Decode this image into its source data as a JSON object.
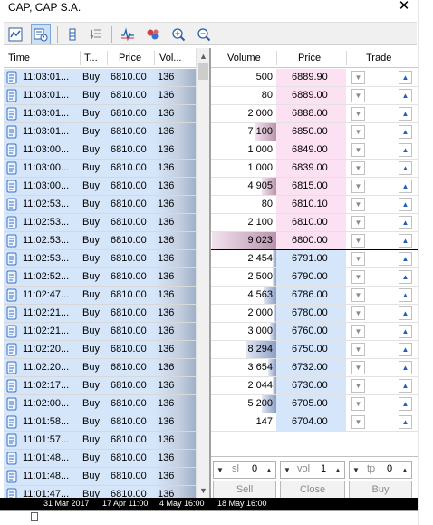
{
  "window": {
    "title": "CAP, CAP S.A.",
    "close_glyph": "✕"
  },
  "toolbar": {
    "buttons": [
      {
        "icon": "chart-mode-icon",
        "active": false
      },
      {
        "icon": "depth-time-sales-icon",
        "active": true
      },
      {
        "icon": "column-bar-icon",
        "active": false
      },
      {
        "icon": "reorder-list-icon",
        "active": false
      },
      {
        "icon": "tick-chart-icon",
        "active": false
      },
      {
        "icon": "color-dots-icon",
        "active": false
      },
      {
        "icon": "zoom-in-icon",
        "active": false
      },
      {
        "icon": "zoom-out-icon",
        "active": false
      }
    ]
  },
  "time_sales": {
    "headers": {
      "time": "Time",
      "type": "T...",
      "price": "Price",
      "volume": "Vol..."
    },
    "rows": [
      {
        "time": "11:03:01...",
        "type": "Buy",
        "price": "6810.00",
        "volume": "136"
      },
      {
        "time": "11:03:01...",
        "type": "Buy",
        "price": "6810.00",
        "volume": "136"
      },
      {
        "time": "11:03:01...",
        "type": "Buy",
        "price": "6810.00",
        "volume": "136"
      },
      {
        "time": "11:03:01...",
        "type": "Buy",
        "price": "6810.00",
        "volume": "136"
      },
      {
        "time": "11:03:00...",
        "type": "Buy",
        "price": "6810.00",
        "volume": "136"
      },
      {
        "time": "11:03:00...",
        "type": "Buy",
        "price": "6810.00",
        "volume": "136"
      },
      {
        "time": "11:03:00...",
        "type": "Buy",
        "price": "6810.00",
        "volume": "136"
      },
      {
        "time": "11:02:53...",
        "type": "Buy",
        "price": "6810.00",
        "volume": "136"
      },
      {
        "time": "11:02:53...",
        "type": "Buy",
        "price": "6810.00",
        "volume": "136"
      },
      {
        "time": "11:02:53...",
        "type": "Buy",
        "price": "6810.00",
        "volume": "136"
      },
      {
        "time": "11:02:53...",
        "type": "Buy",
        "price": "6810.00",
        "volume": "136"
      },
      {
        "time": "11:02:52...",
        "type": "Buy",
        "price": "6810.00",
        "volume": "136"
      },
      {
        "time": "11:02:47...",
        "type": "Buy",
        "price": "6810.00",
        "volume": "136"
      },
      {
        "time": "11:02:21...",
        "type": "Buy",
        "price": "6810.00",
        "volume": "136"
      },
      {
        "time": "11:02:21...",
        "type": "Buy",
        "price": "6810.00",
        "volume": "136"
      },
      {
        "time": "11:02:20...",
        "type": "Buy",
        "price": "6810.00",
        "volume": "136"
      },
      {
        "time": "11:02:20...",
        "type": "Buy",
        "price": "6810.00",
        "volume": "136"
      },
      {
        "time": "11:02:17...",
        "type": "Buy",
        "price": "6810.00",
        "volume": "136"
      },
      {
        "time": "11:02:00...",
        "type": "Buy",
        "price": "6810.00",
        "volume": "136"
      },
      {
        "time": "11:01:58...",
        "type": "Buy",
        "price": "6810.00",
        "volume": "136"
      },
      {
        "time": "11:01:57...",
        "type": "Buy",
        "price": "6810.00",
        "volume": "136"
      },
      {
        "time": "11:01:48...",
        "type": "Buy",
        "price": "6810.00",
        "volume": "136"
      },
      {
        "time": "11:01:48...",
        "type": "Buy",
        "price": "6810.00",
        "volume": "136"
      },
      {
        "time": "11:01:47...",
        "type": "Buy",
        "price": "6810.00",
        "volume": "136"
      }
    ]
  },
  "depth_of_market": {
    "headers": {
      "volume": "Volume",
      "price": "Price",
      "trade": "Trade"
    },
    "asks": [
      {
        "volume": "500",
        "price": "6889.90",
        "volume_level": 0.0
      },
      {
        "volume": "80",
        "price": "6889.00",
        "volume_level": 0.0
      },
      {
        "volume": "2 000",
        "price": "6888.00",
        "volume_level": 0.0
      },
      {
        "volume": "7 100",
        "price": "6850.00",
        "volume_level": 0.32
      },
      {
        "volume": "1 000",
        "price": "6849.00",
        "volume_level": 0.0
      },
      {
        "volume": "1 000",
        "price": "6839.00",
        "volume_level": 0.0
      },
      {
        "volume": "4 905",
        "price": "6815.00",
        "volume_level": 0.22
      },
      {
        "volume": "80",
        "price": "6810.10",
        "volume_level": 0.0
      },
      {
        "volume": "2 100",
        "price": "6810.00",
        "volume_level": 0.0
      },
      {
        "volume": "9 023",
        "price": "6800.00",
        "volume_level": 0.98
      }
    ],
    "bids": [
      {
        "volume": "2 454",
        "price": "6791.00",
        "volume_level": 0.05
      },
      {
        "volume": "2 500",
        "price": "6790.00",
        "volume_level": 0.05
      },
      {
        "volume": "4 563",
        "price": "6786.00",
        "volume_level": 0.2
      },
      {
        "volume": "2 000",
        "price": "6780.00",
        "volume_level": 0.03
      },
      {
        "volume": "3 000",
        "price": "6760.00",
        "volume_level": 0.1
      },
      {
        "volume": "8 294",
        "price": "6750.00",
        "volume_level": 0.46
      },
      {
        "volume": "3 654",
        "price": "6732.00",
        "volume_level": 0.12
      },
      {
        "volume": "2 044",
        "price": "6730.00",
        "volume_level": 0.05
      },
      {
        "volume": "5 200",
        "price": "6705.00",
        "volume_level": 0.22
      },
      {
        "volume": "147",
        "price": "6704.00",
        "volume_level": 0.0
      }
    ],
    "controls": {
      "sl_label": "sl",
      "sl_value": "0",
      "vol_label": "vol",
      "vol_value": "1",
      "tp_label": "tp",
      "tp_value": "0"
    },
    "actions": {
      "sell": "Sell",
      "close": "Close",
      "buy": "Buy"
    }
  },
  "bottom_axis": {
    "labels": [
      "31 Mar 2017",
      "17 Apr 11:00",
      "4 May 16:00",
      "18 May 16:00"
    ]
  },
  "colors": {
    "bid_bg": "#d6e6fa",
    "ask_bg": "#fbe1f2",
    "active_button": "#cce0f5",
    "buy_arrow": "#1f5fbf"
  }
}
